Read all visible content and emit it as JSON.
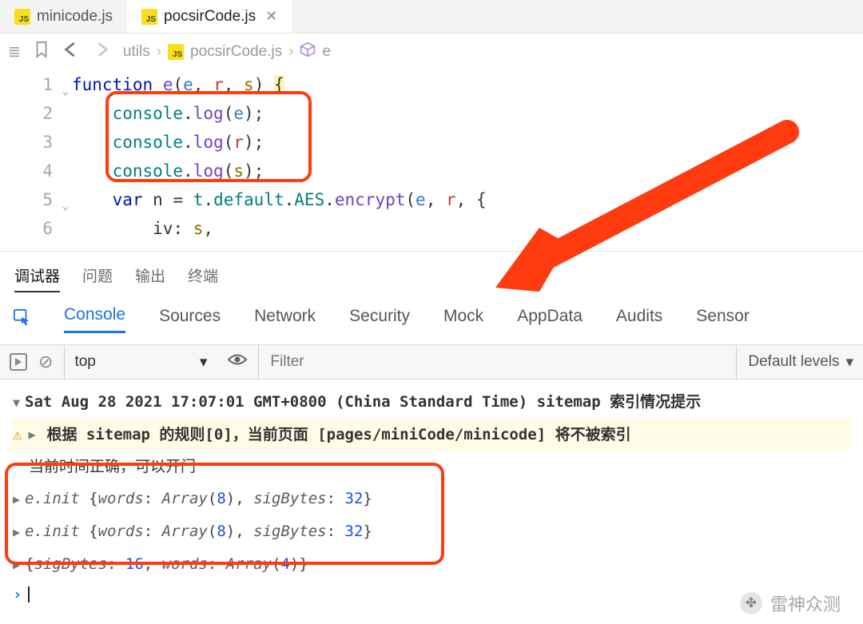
{
  "tabs": {
    "items": [
      {
        "label": "minicode.js",
        "active": false
      },
      {
        "label": "pocsirCode.js",
        "active": true
      }
    ]
  },
  "breadcrumbs": {
    "folder": "utils",
    "file": "pocsirCode.js",
    "symbol": "e"
  },
  "code": {
    "lines": [
      {
        "n": "1",
        "fold": true
      },
      {
        "n": "2"
      },
      {
        "n": "3"
      },
      {
        "n": "4"
      },
      {
        "n": "5",
        "fold": true
      },
      {
        "n": "6"
      }
    ],
    "tokens": {
      "function": "function",
      "fn_name": "e",
      "p_e": "e",
      "p_r": "r",
      "p_s": "s",
      "console": "console",
      "log": "log",
      "var": "var",
      "n": "n",
      "t": "t",
      "default": "default",
      "AES": "AES",
      "encrypt": "encrypt",
      "iv": "iv"
    }
  },
  "bottom_panels": {
    "items": [
      "调试器",
      "问题",
      "输出",
      "终端"
    ],
    "active": 0
  },
  "devtools": {
    "items": [
      "Console",
      "Sources",
      "Network",
      "Security",
      "Mock",
      "AppData",
      "Audits",
      "Sensor"
    ],
    "active": 0
  },
  "console_bar": {
    "context": "top",
    "filter_placeholder": "Filter",
    "levels_label": "Default levels"
  },
  "console": {
    "header": "Sat Aug 28 2021 17:07:01 GMT+0800 (China Standard Time) sitemap 索引情况提示",
    "warn": "根据 sitemap 的规则[0]，当前页面 [pages/miniCode/minicode] 将不被索引",
    "msg1": "当前时间正确，可以开门",
    "objs": [
      {
        "prefix": "e.init ",
        "words_cnt": "8",
        "sigBytes": "32"
      },
      {
        "prefix": "e.init ",
        "words_cnt": "8",
        "sigBytes": "32"
      },
      {
        "prefix": "",
        "sigBytes_first": "16",
        "words_cnt": "4"
      }
    ],
    "labels": {
      "words": "words",
      "sigBytes": "sigBytes",
      "Array": "Array"
    }
  },
  "watermark": {
    "text": "雷神众测"
  },
  "prompt": "›"
}
